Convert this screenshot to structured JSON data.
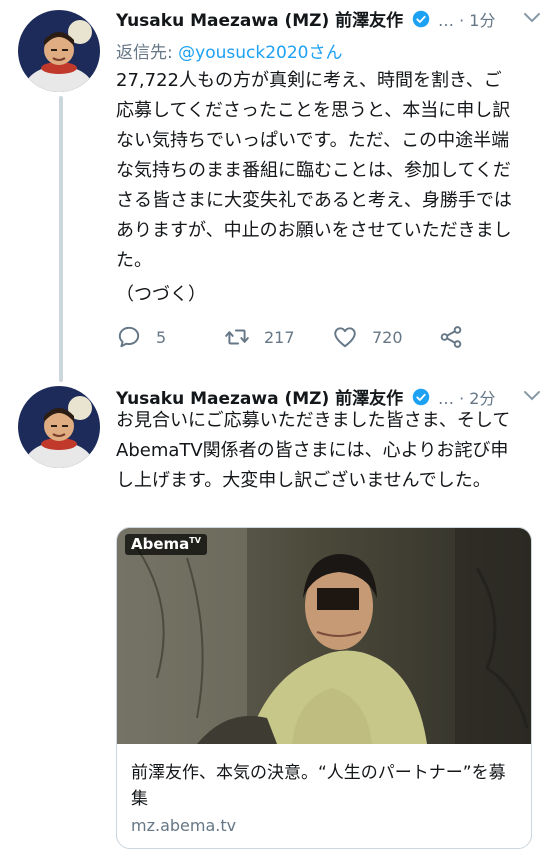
{
  "thread": [
    {
      "author_name": "Yusaku Maezawa (MZ) 前澤友作",
      "meta": "… · 1分",
      "reply_prefix": "返信先: ",
      "reply_handle": "@yousuck2020さん",
      "body": "27,722人もの方が真剣に考え、時間を割き、ご応募してくださったことを思うと、本当に申し訳ない気持ちでいっぱいです。ただ、この中途半端な気持ちのまま番組に臨むことは、参加してくださる皆さまに大変失礼であると考え、身勝手ではありますが、中止のお願いをさせていただきました。",
      "body_continued": "（つづく）",
      "actions": {
        "reply_count": "5",
        "retweet_count": "217",
        "like_count": "720"
      }
    },
    {
      "author_name": "Yusaku Maezawa (MZ) 前澤友作",
      "meta": "… · 2分",
      "body": "お見合いにご応募いただきました皆さま、そしてAbemaTV関係者の皆さまには、心よりお詫び申し上げます。大変申し訳ございませんでした。",
      "card": {
        "logo_text": "Abema",
        "logo_sup": "TV",
        "title": "前澤友作、本気の決意。“人生のパートナー”を募集",
        "url": "mz.abema.tv"
      }
    }
  ],
  "colors": {
    "accent": "#1da1f2",
    "secondary_text": "#657786",
    "thread_line": "#ccd6dd"
  }
}
